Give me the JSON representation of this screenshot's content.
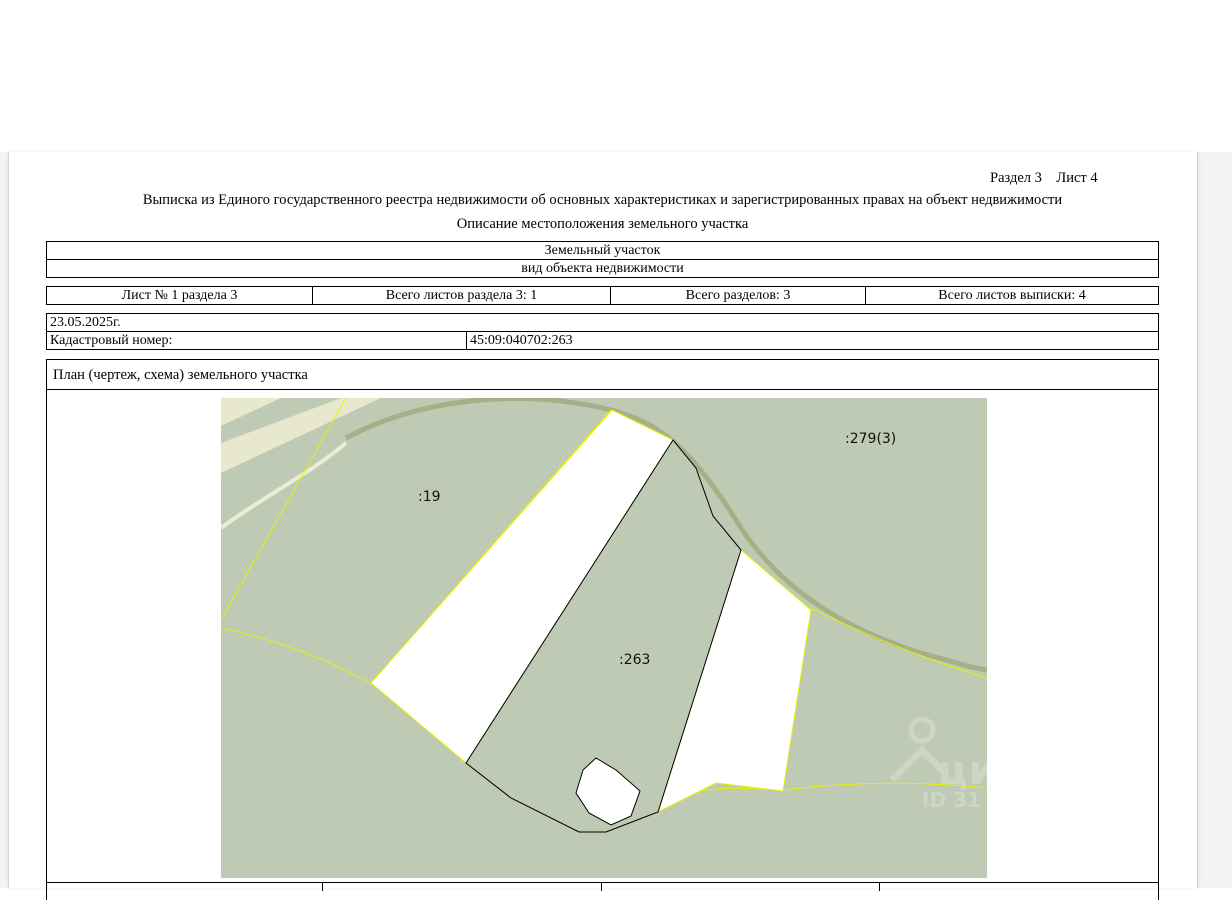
{
  "header": {
    "section_sheet": "Раздел 3    Лист 4",
    "title": "Выписка из Единого государственного реестра недвижимости об основных характеристиках и зарегистрированных правах на объект недвижимости",
    "subtitle": "Описание местоположения земельного участка"
  },
  "object": {
    "type": "Земельный участок",
    "type_caption": "вид объекта недвижимости"
  },
  "sheets": {
    "sheet_of_section": "Лист № 1 раздела 3",
    "total_section_sheets": "Всего листов раздела 3: 1",
    "total_sections": "Всего разделов: 3",
    "total_extract_sheets": "Всего листов выписки: 4"
  },
  "record": {
    "date": "23.05.2025г.",
    "cadastral_label": "Кадастровый номер:",
    "cadastral_number": "45:09:040702:263"
  },
  "plan": {
    "header": "План (чертеж, схема) земельного участка",
    "labels": {
      "parcel_279": ":279(3)",
      "parcel_19": ":19",
      "parcel_263": ":263"
    },
    "colors": {
      "parcel_fill": "#bfcab4",
      "boundary_line": "#e8f000",
      "road_line": "#a6b088",
      "target_outline": "#000000"
    }
  },
  "watermark": {
    "brand": "циан",
    "id_prefix": "ID 31"
  }
}
